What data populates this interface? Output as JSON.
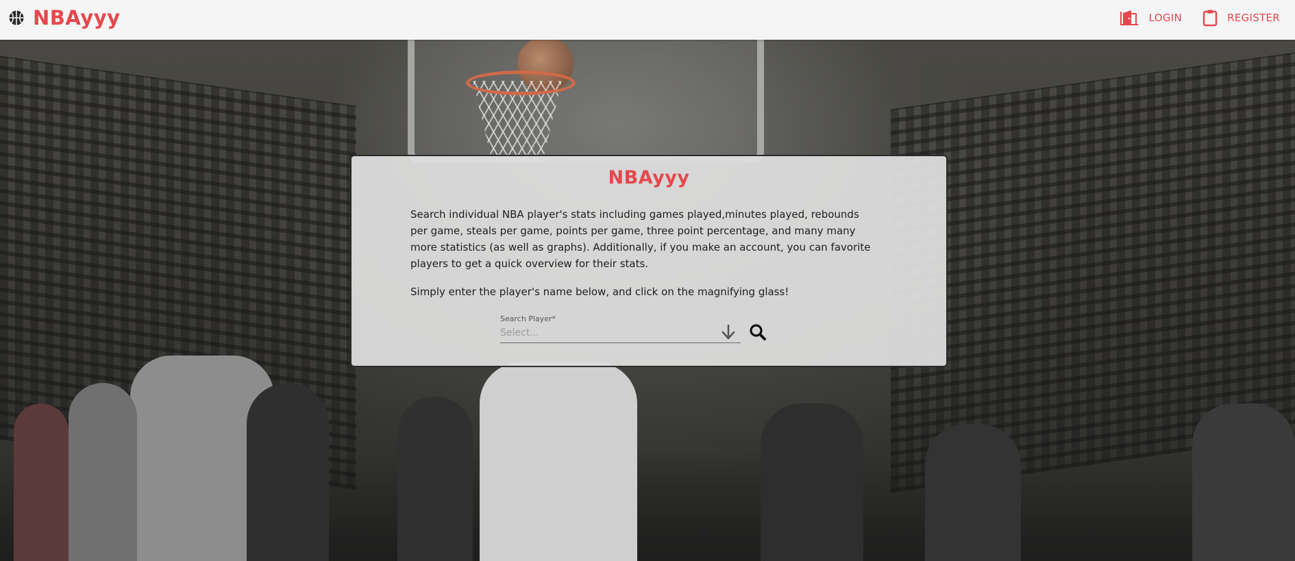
{
  "header": {
    "brand": "NBAyyy",
    "brand_icon": "basketball-icon",
    "login_label": "LOGIN",
    "login_icon": "door-icon",
    "register_label": "REGISTER",
    "register_icon": "clipboard-icon"
  },
  "card": {
    "title": "NBAyyy",
    "description": "Search individual NBA player's stats including games played,minutes played, rebounds per game, steals per game, points per game, three point percentage, and many many more statistics (as well as graphs). Additionally, if you make an account, you can favorite players to get a quick overview for their stats.",
    "instruction": "Simply enter the player's name below, and click on the magnifying glass!",
    "search": {
      "label": "Search Player*",
      "placeholder": "Select...",
      "dropdown_icon": "arrow-down-icon",
      "submit_icon": "search-icon"
    }
  },
  "colors": {
    "accent": "#e5484d",
    "header_bg": "#f5f5f5",
    "card_bg": "#dedede"
  }
}
